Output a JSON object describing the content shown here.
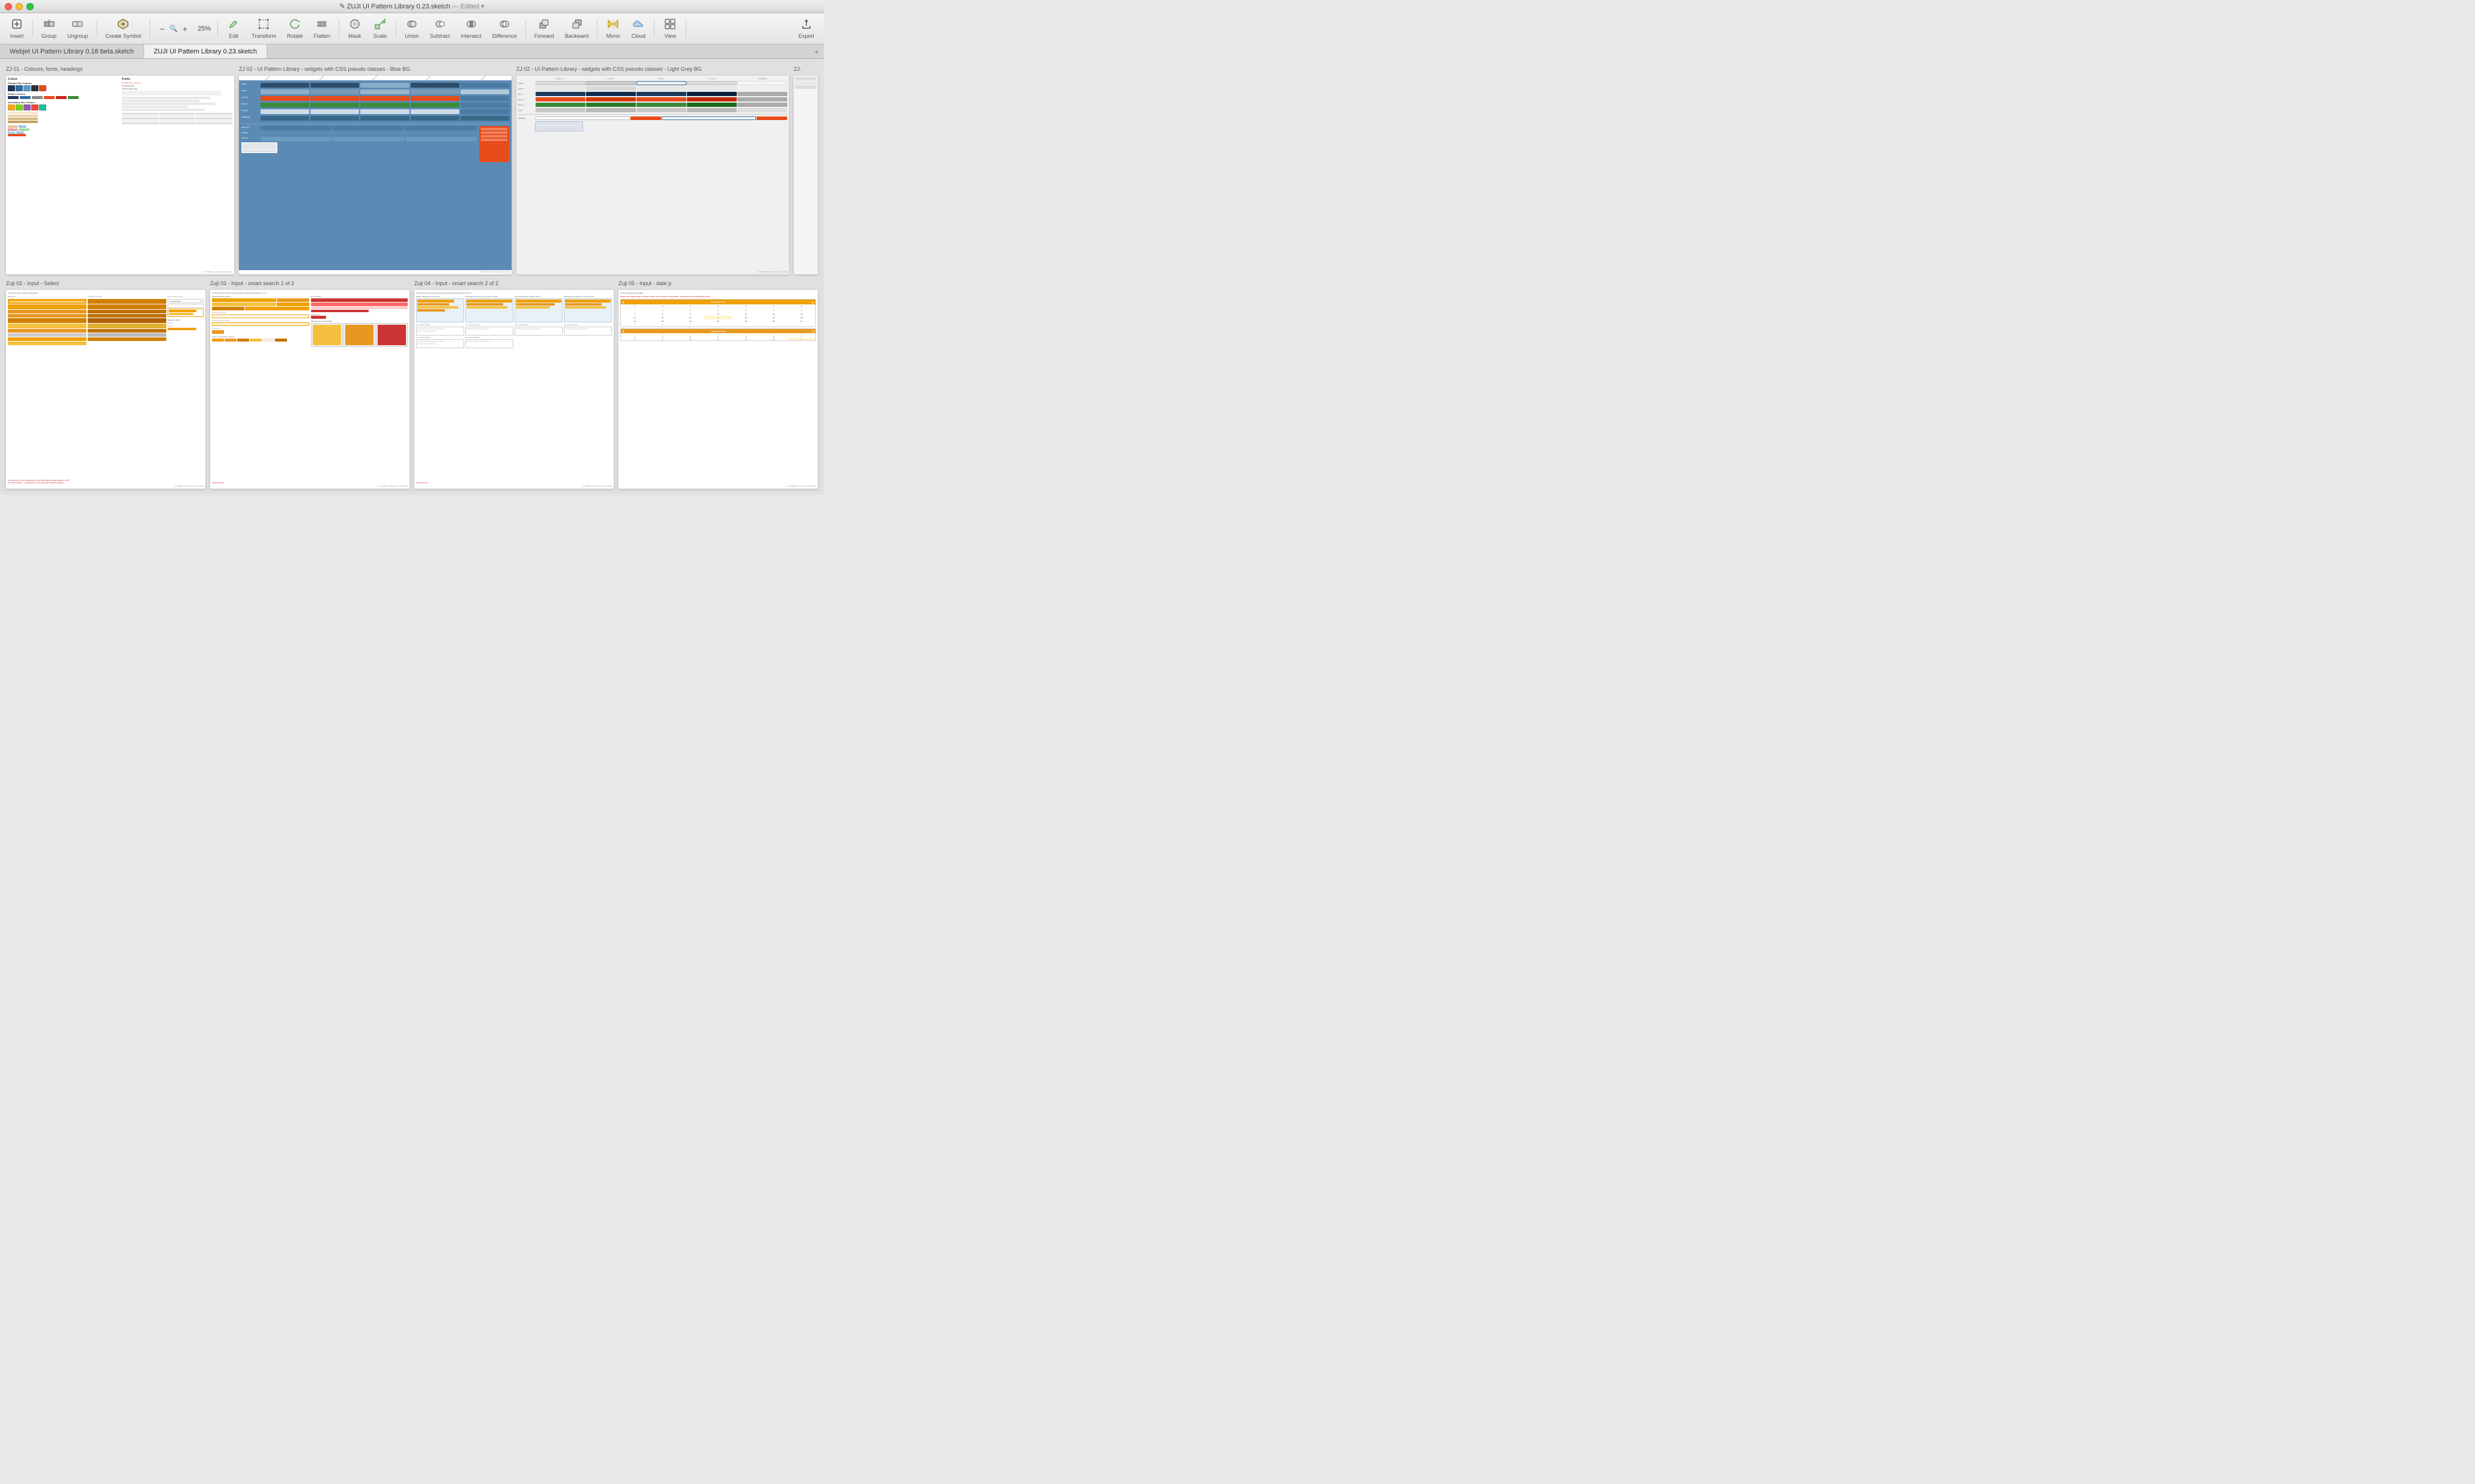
{
  "titlebar": {
    "title": "ZUJI UI Pattern Library 0.23.sketch",
    "separator": "—",
    "edited_label": "Edited",
    "dropdown_icon": "▾"
  },
  "traffic_lights": {
    "close_title": "Close",
    "minimize_title": "Minimize",
    "maximize_title": "Maximize"
  },
  "toolbar": {
    "insert_label": "Insert",
    "group_label": "Group",
    "ungroup_label": "Ungroup",
    "create_symbol_label": "Create Symbol",
    "zoom_minus": "−",
    "zoom_value": "25%",
    "zoom_plus": "+",
    "edit_label": "Edit",
    "transform_label": "Transform",
    "rotate_label": "Rotate",
    "flatten_label": "Flatten",
    "mask_label": "Mask",
    "scale_label": "Scale",
    "union_label": "Union",
    "subtract_label": "Subtract",
    "intersect_label": "Intersect",
    "difference_label": "Difference",
    "forward_label": "Forward",
    "backward_label": "Backward",
    "mirror_label": "Mirror",
    "cloud_label": "Cloud",
    "view_label": "View",
    "export_label": "Export"
  },
  "tabs": {
    "left_tab": "Webjet UI Pattern Library 0.18 beta.sketch",
    "right_tab": "ZUJI UI Pattern Library 0.23.sketch",
    "add_label": "+"
  },
  "artboards": {
    "row1": [
      {
        "title": "ZJ 01 - Colours, fonts, headings",
        "footer": "ZJ Pattern Library 0.23 beta"
      },
      {
        "title": "ZJ 02 - UI Pattern Library - widgets with CSS pseudo classes - Blue BG",
        "footer": "ZJ Pattern Library 0.23 beta"
      },
      {
        "title": "ZJ 02 - UI Pattern Library - widgets with CSS pseudo classes - Light Grey BG",
        "footer": "ZJ Pattern Library 0.23 beta"
      },
      {
        "title": "ZJ.",
        "footer": ""
      }
    ],
    "row2": [
      {
        "title": "Zuji 02 - Input - Select",
        "footer": "ZJ Pattern Library 0.23 beta"
      },
      {
        "title": "Zuji 03 - Input - smart search 1 of 2",
        "footer": "ZJ Pattern Library 0.23 beta"
      },
      {
        "title": "Zuji 04 - Input - smart search 2 of 2",
        "footer": "ZJ Pattern Library 0.23 beta"
      },
      {
        "title": "Zuji 05 - Input - date p",
        "footer": "ZJ Pattern Library 0.23 beta"
      }
    ]
  }
}
